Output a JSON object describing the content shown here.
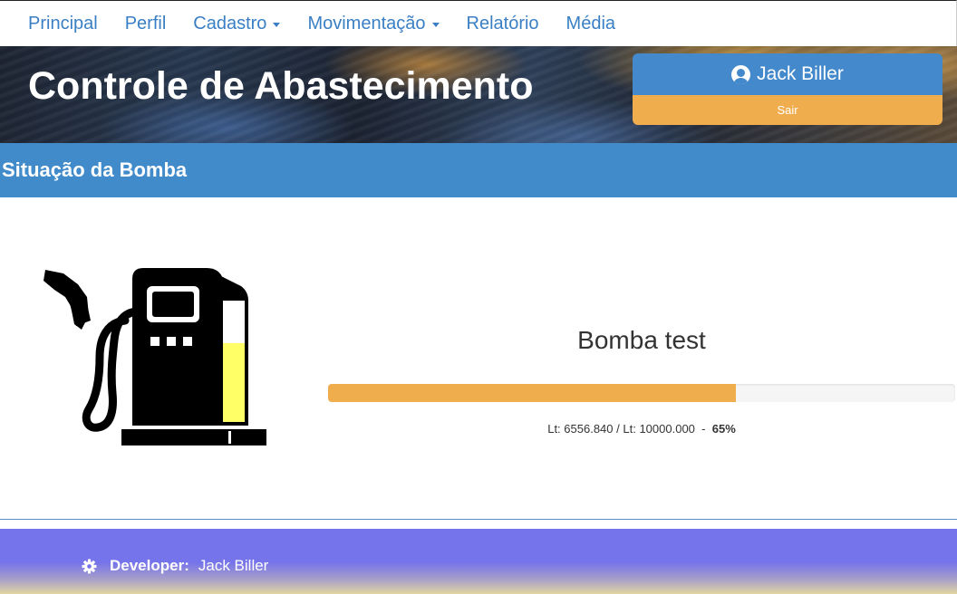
{
  "nav": {
    "items": [
      {
        "label": "Principal",
        "dropdown": false
      },
      {
        "label": "Perfil",
        "dropdown": false
      },
      {
        "label": "Cadastro",
        "dropdown": true
      },
      {
        "label": "Movimentação",
        "dropdown": true
      },
      {
        "label": "Relatório",
        "dropdown": false
      },
      {
        "label": "Média",
        "dropdown": false
      }
    ]
  },
  "header": {
    "title": "Controle de Abastecimento",
    "user": {
      "name": "Jack Biller",
      "icon": "user-circle-icon"
    },
    "logout_label": "Sair"
  },
  "section": {
    "title": "Situação da Bomba"
  },
  "pump": {
    "icon": "fuel-pump-icon",
    "fuel_level": 0.65,
    "name": "Bomba test",
    "progress_percent": 65,
    "current_label": "Lt: 6556.840",
    "separator": "/",
    "capacity_label": "Lt: 10000.000",
    "dash": "-",
    "percent_label": "65%"
  },
  "footer": {
    "icon": "gear-icon",
    "developer_label": "Developer:",
    "developer_name": "Jack Biller"
  },
  "colors": {
    "primary": "#428bca",
    "warning": "#f0ad4e",
    "nav_link": "#3a7fc4",
    "footer": "#7674ea",
    "fuel": "#ffff66"
  }
}
